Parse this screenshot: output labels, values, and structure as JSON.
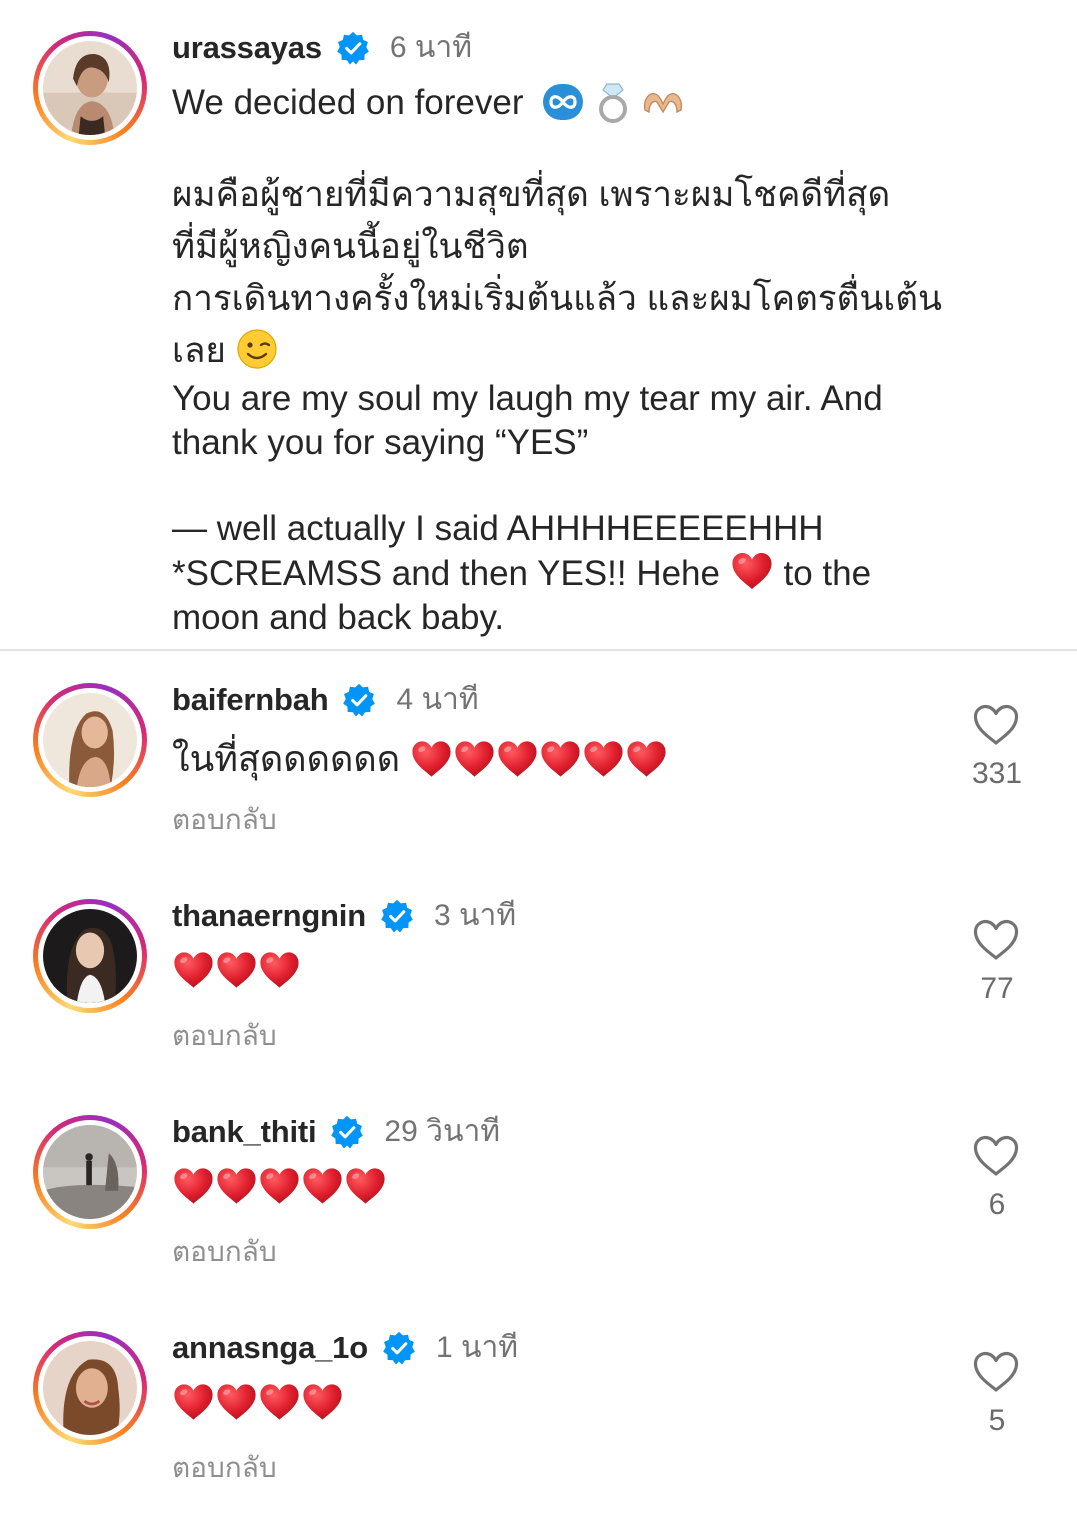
{
  "post": {
    "username": "urassayas",
    "time": "6 นาที",
    "caption_lines": [
      "We decided on forever",
      "",
      "ผมคือผู้ชายที่มีความสุขที่สุด เพราะผมโชคดีที่สุด",
      "ที่มีผู้หญิงคนนี้อยู่ในชีวิต",
      "การเดินทางครั้งใหม่เริ่มต้นแล้ว และผมโคตรตื่นเต้น",
      "เลย",
      "You are my soul my laugh my tear my air. And",
      "thank you for saying “YES”",
      "",
      "— well actually I said AHHHHEEEEEHHH",
      "*SCREAMSS and then YES!! Hehe",
      "to the",
      "moon and back baby."
    ],
    "emojis": [
      "infinity-emoji",
      "ring-emoji",
      "heart-hands-emoji",
      "wink-emoji",
      "red-heart-emoji"
    ]
  },
  "comments": [
    {
      "username": "baifernbah",
      "time": "4 นาที",
      "text": "ในที่สุดดดดดด",
      "hearts": 6,
      "reply": "ตอบกลับ",
      "likes": "331"
    },
    {
      "username": "thanaerngnin",
      "time": "3 นาที",
      "text": "",
      "hearts": 3,
      "reply": "ตอบกลับ",
      "likes": "77"
    },
    {
      "username": "bank_thiti",
      "time": "29 วินาที",
      "text": "",
      "hearts": 5,
      "reply": "ตอบกลับ",
      "likes": "6"
    },
    {
      "username": "annasnga_1o",
      "time": "1 นาที",
      "text": "",
      "hearts": 4,
      "reply": "ตอบกลับ",
      "likes": "5"
    }
  ],
  "colors": {
    "verified": "#0095f6",
    "heart": "#e0202e",
    "text": "#262626",
    "secondary": "#737373"
  }
}
